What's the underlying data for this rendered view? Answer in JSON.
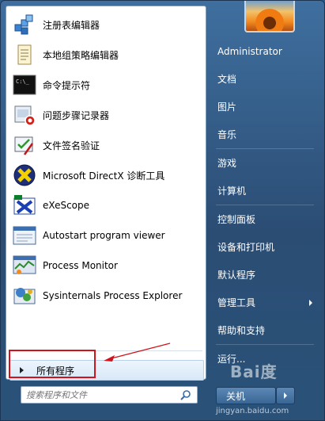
{
  "left_programs": [
    {
      "label": "注册表编辑器",
      "icon": "registry-editor-icon"
    },
    {
      "label": "本地组策略编辑器",
      "icon": "group-policy-icon"
    },
    {
      "label": "命令提示符",
      "icon": "command-prompt-icon"
    },
    {
      "label": "问题步骤记录器",
      "icon": "steps-recorder-icon"
    },
    {
      "label": "文件签名验证",
      "icon": "file-signature-icon"
    },
    {
      "label": "Microsoft DirectX 诊断工具",
      "icon": "directx-icon"
    },
    {
      "label": "eXeScope",
      "icon": "exescope-icon"
    },
    {
      "label": "Autostart program viewer",
      "icon": "autostart-viewer-icon"
    },
    {
      "label": "Process Monitor",
      "icon": "process-monitor-icon"
    },
    {
      "label": "Sysinternals Process Explorer",
      "icon": "process-explorer-icon"
    }
  ],
  "all_programs_label": "所有程序",
  "search": {
    "placeholder": "搜索程序和文件"
  },
  "right_items": [
    {
      "label": "Administrator",
      "has_submenu": false
    },
    {
      "label": "文档",
      "has_submenu": false
    },
    {
      "label": "图片",
      "has_submenu": false
    },
    {
      "label": "音乐",
      "has_submenu": false
    },
    {
      "label": "游戏",
      "has_submenu": false
    },
    {
      "label": "计算机",
      "has_submenu": false
    },
    {
      "label": "控制面板",
      "has_submenu": false
    },
    {
      "label": "设备和打印机",
      "has_submenu": false
    },
    {
      "label": "默认程序",
      "has_submenu": false
    },
    {
      "label": "管理工具",
      "has_submenu": true
    },
    {
      "label": "帮助和支持",
      "has_submenu": false
    },
    {
      "label": "运行...",
      "has_submenu": false
    }
  ],
  "shutdown_label": "关机",
  "watermark": "Bai度",
  "watermark_sub": "jingyan.baidu.com",
  "colors": {
    "annotation": "#d0141d",
    "menu_accent": "#2b4d74"
  }
}
